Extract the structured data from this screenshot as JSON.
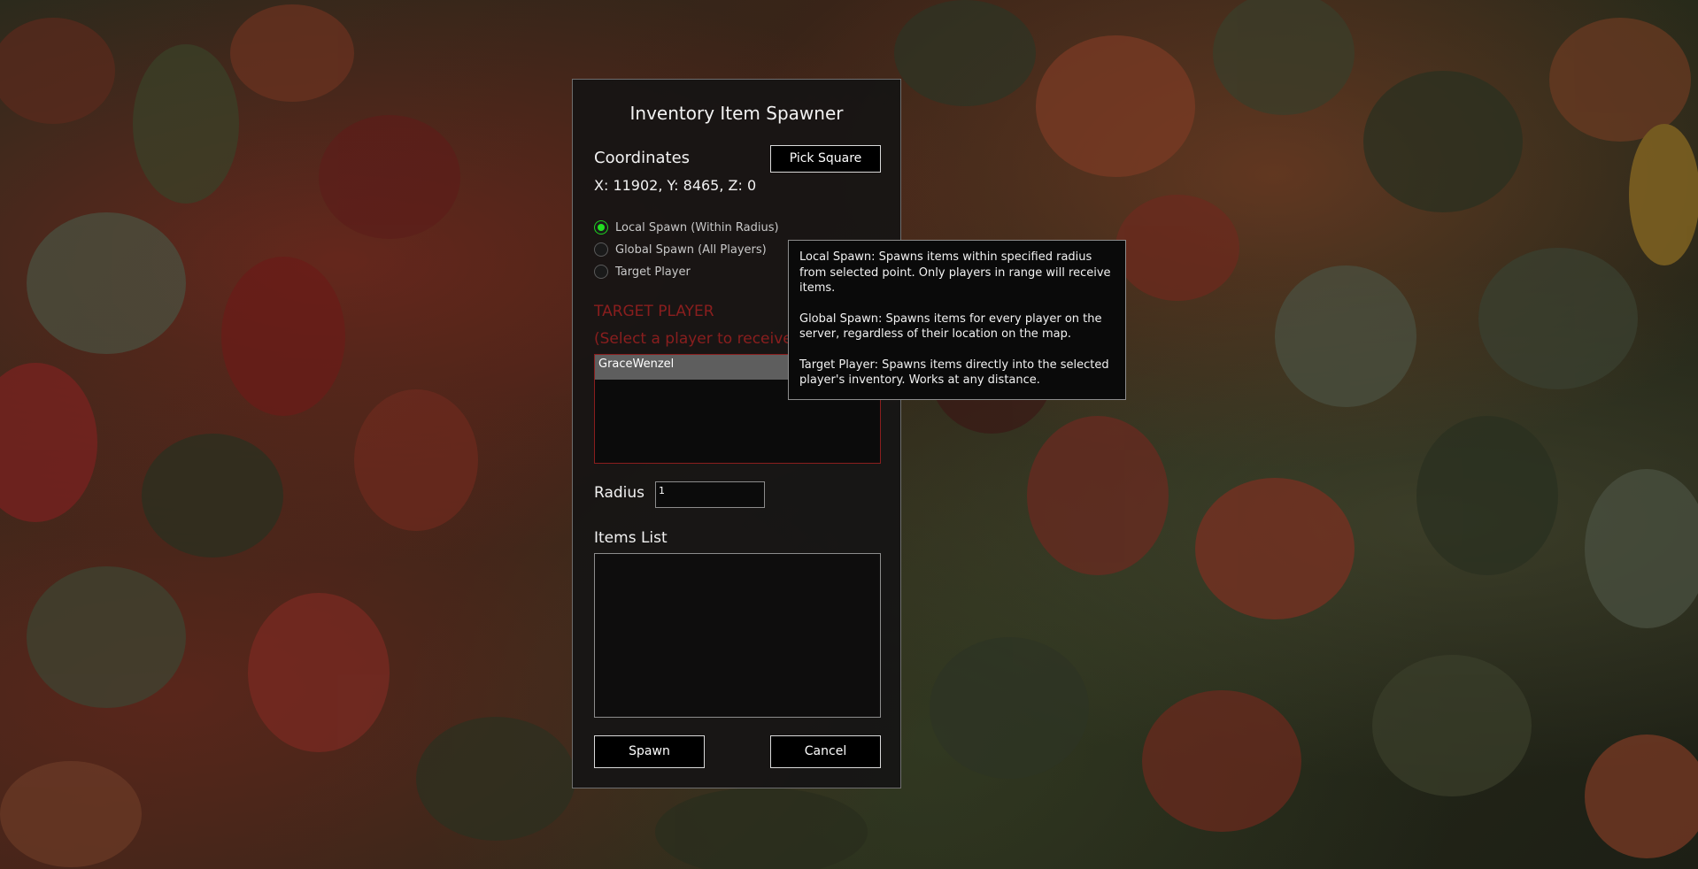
{
  "window": {
    "title": "Inventory Item Spawner"
  },
  "coordinates": {
    "label": "Coordinates",
    "value": "X: 11902, Y: 8465, Z: 0",
    "pick_button": "Pick Square"
  },
  "spawn_modes": [
    {
      "label": "Local Spawn (Within Radius)",
      "selected": true
    },
    {
      "label": "Global Spawn (All Players)",
      "selected": false
    },
    {
      "label": "Target Player",
      "selected": false
    }
  ],
  "target_player": {
    "header": "TARGET PLAYER",
    "subheader": "(Select a player to receive ",
    "players": [
      "GraceWenzel"
    ],
    "selected_player": "GraceWenzel"
  },
  "radius": {
    "label": "Radius",
    "value": "1"
  },
  "items": {
    "label": "Items List",
    "entries": []
  },
  "buttons": {
    "spawn": "Spawn",
    "cancel": "Cancel"
  },
  "tooltip": {
    "local": "Local Spawn: Spawns items within specified radius from selected point. Only players in range will receive items.",
    "global": "Global Spawn: Spawns items for every player on the server, regardless of their location on the map.",
    "target": "Target Player: Spawns items directly into the selected player's inventory. Works at any distance."
  },
  "colors": {
    "accent_red": "#8a1e1e",
    "radio_selected": "#22e022",
    "panel_bg": "#161414"
  }
}
